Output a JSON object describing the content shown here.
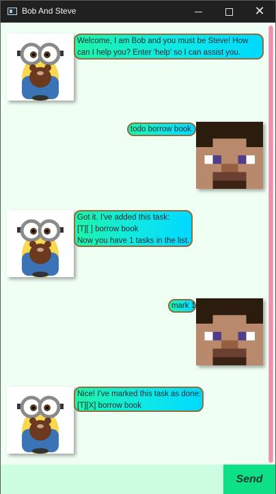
{
  "window": {
    "title": "Bob And Steve"
  },
  "messages": [
    {
      "sender": "bot",
      "lines": [
        "Welcome, I am Bob and you must be Steve! How",
        "can I help you? Enter 'help' so I can assist you."
      ]
    },
    {
      "sender": "user",
      "lines": [
        "todo borrow book"
      ]
    },
    {
      "sender": "bot",
      "lines": [
        "Got it. I've added this task:",
        "[T][ ] borrow book",
        "Now you have 1 tasks in the list."
      ]
    },
    {
      "sender": "user",
      "lines": [
        "mark 1"
      ]
    },
    {
      "sender": "bot",
      "lines": [
        "Nice! I've marked this task as done:",
        "[T][X] borrow book"
      ]
    }
  ],
  "input": {
    "value": "",
    "placeholder": ""
  },
  "send_button": {
    "label": "Send"
  },
  "icons": {
    "bot_avatar": "minion-avatar-icon",
    "user_avatar": "steve-avatar-icon"
  },
  "colors": {
    "background": "#f0fff4",
    "input_background": "#ccffe2",
    "send_button": "#0ee087",
    "bubble_border": "#8a6e3b",
    "scrollbar": "#f7a8bd"
  }
}
